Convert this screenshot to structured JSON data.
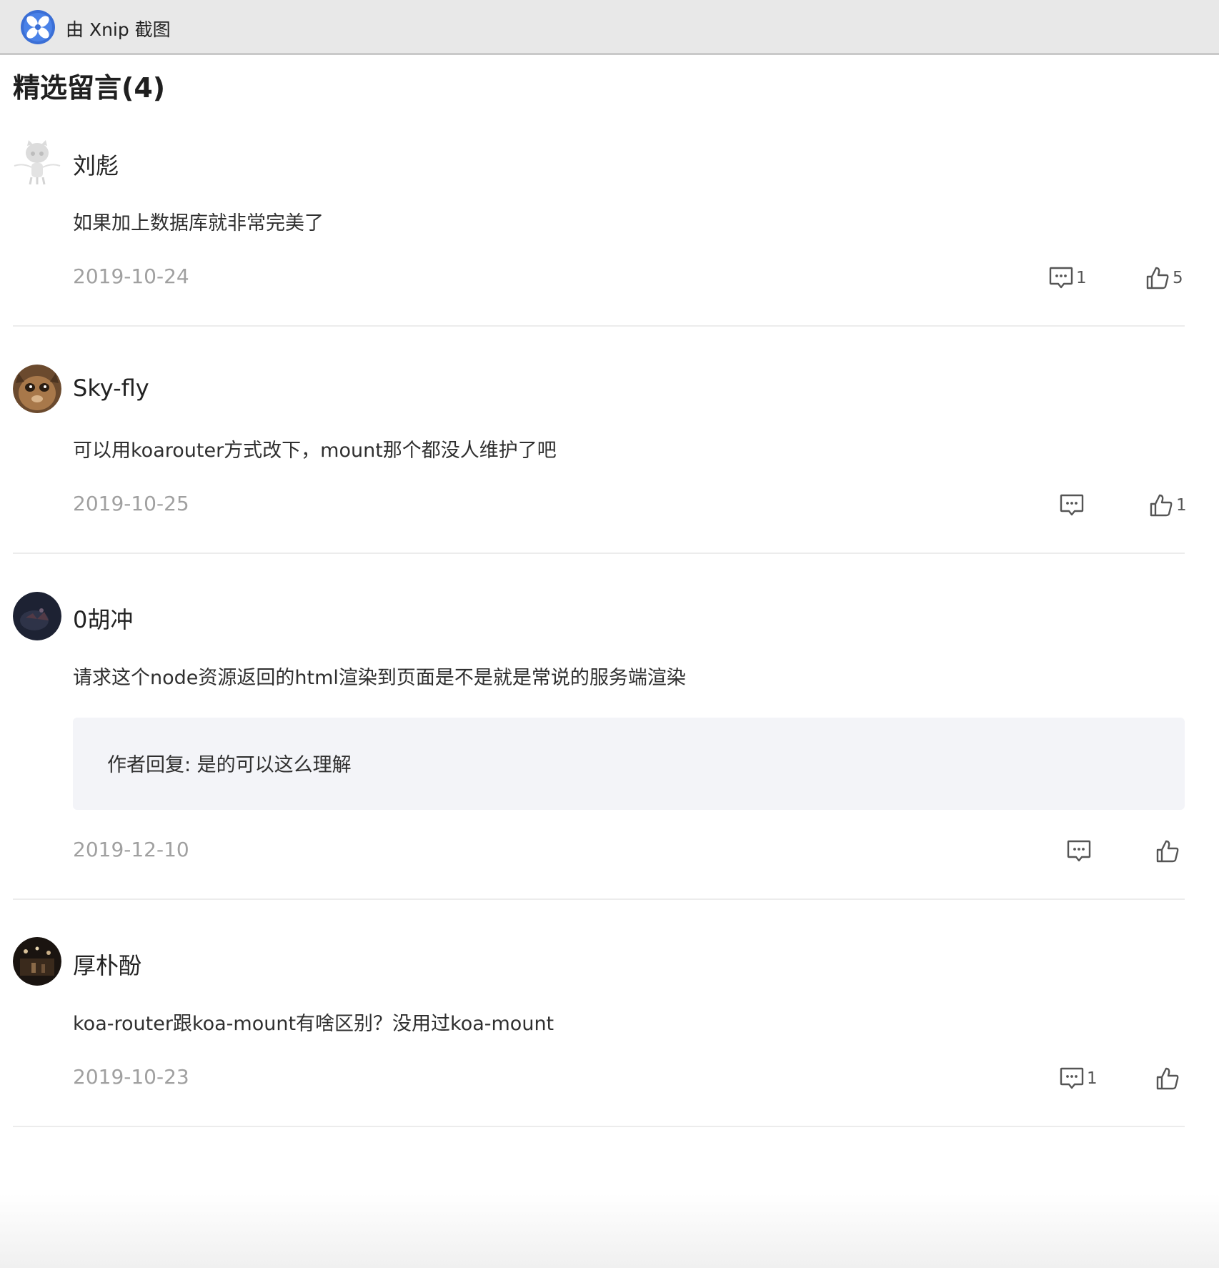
{
  "app": {
    "title": "由 Xnip 截图"
  },
  "section": {
    "title": "精选留言(4)"
  },
  "comments": [
    {
      "username": "刘彪",
      "content": "如果加上数据库就非常完美了",
      "date": "2019-10-24",
      "reply_count": "1",
      "like_count": "5"
    },
    {
      "username": "Sky-fly",
      "content": "可以用koarouter方式改下，mount那个都没人维护了吧",
      "date": "2019-10-25",
      "reply_count": "",
      "like_count": "1"
    },
    {
      "username": "0胡冲",
      "content": "请求这个node资源返回的html渲染到页面是不是就是常说的服务端渲染",
      "author_reply": "作者回复: 是的可以这么理解",
      "date": "2019-12-10",
      "reply_count": "",
      "like_count": ""
    },
    {
      "username": "厚朴酚",
      "content": "koa-router跟koa-mount有啥区别？没用过koa-mount",
      "date": "2019-10-23",
      "reply_count": "1",
      "like_count": ""
    }
  ],
  "icons": {
    "app_logo": "xnip-logo-icon",
    "comment": "comment-icon",
    "like": "thumbs-up-icon"
  },
  "colors": {
    "titlebar": "#e8e8e8",
    "reply_box": "#f3f4f8",
    "date": "#a0a0a0",
    "logo": "#3b6fd6"
  }
}
